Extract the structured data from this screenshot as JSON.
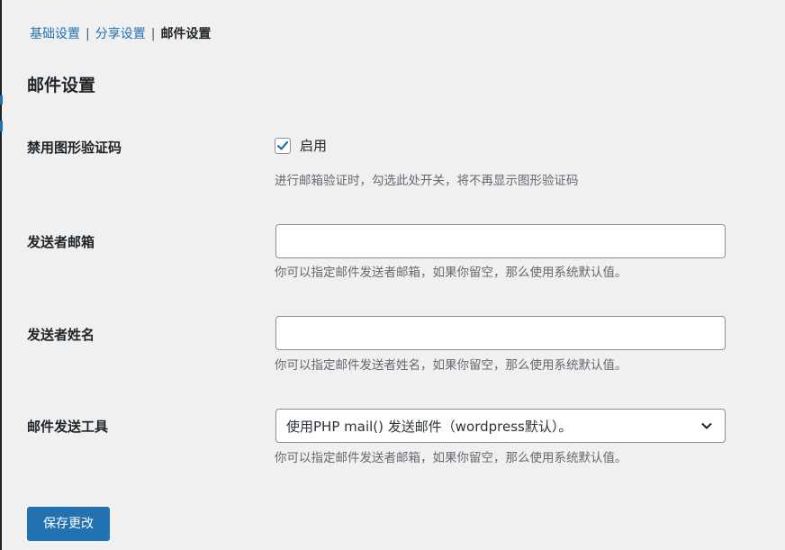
{
  "subnav": {
    "items": [
      {
        "label": "基础设置"
      },
      {
        "label": "分享设置"
      },
      {
        "label": "邮件设置"
      }
    ],
    "separator": "|"
  },
  "page_title": "邮件设置",
  "settings": {
    "disable_captcha": {
      "label": "禁用图形验证码",
      "checkbox_label": "启用",
      "checked": true,
      "description": "进行邮箱验证时，勾选此处开关，将不再显示图形验证码"
    },
    "sender_email": {
      "label": "发送者邮箱",
      "value": "",
      "description": "你可以指定邮件发送者邮箱，如果你留空，那么使用系统默认值。"
    },
    "sender_name": {
      "label": "发送者姓名",
      "value": "",
      "description": "你可以指定邮件发送者姓名，如果你留空，那么使用系统默认值。"
    },
    "mail_tool": {
      "label": "邮件发送工具",
      "selected": "使用PHP mail() 发送邮件（wordpress默认）。",
      "description": "你可以指定邮件发送者邮箱，如果你留空，那么使用系统默认值。"
    }
  },
  "save_button": "保存更改",
  "colors": {
    "accent": "#2271b1",
    "background": "#f0f0f1",
    "text": "#1d2327",
    "muted": "#646970"
  }
}
